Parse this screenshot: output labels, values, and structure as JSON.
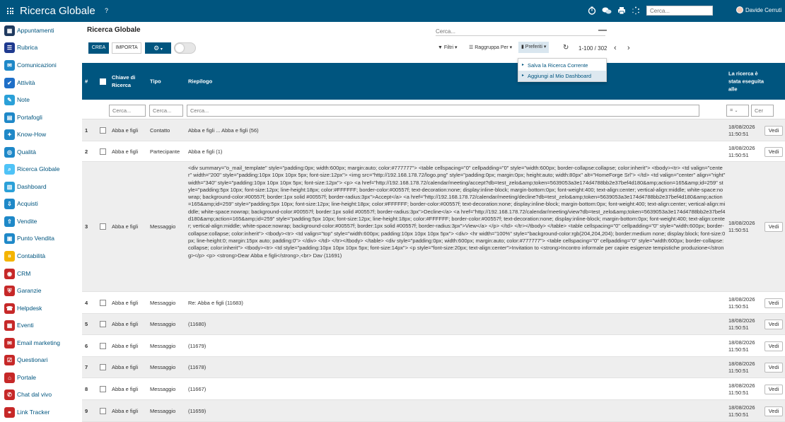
{
  "topbar": {
    "title": "Ricerca Globale",
    "help": "?",
    "search_placeholder": "Cerca...",
    "user": "Davide Cerruti"
  },
  "sidebar": {
    "items": [
      {
        "label": "Appuntamenti",
        "icon": "calendar-icon",
        "color": "#1f3a5f"
      },
      {
        "label": "Rubrica",
        "icon": "contacts-icon",
        "color": "#1f3a8f"
      },
      {
        "label": "Comunicazioni",
        "icon": "chat-icon",
        "color": "#1e88c8"
      },
      {
        "label": "Attività",
        "icon": "check-icon",
        "color": "#1e6fc8"
      },
      {
        "label": "Note",
        "icon": "notes-icon",
        "color": "#2aa0d8"
      },
      {
        "label": "Portafogli",
        "icon": "wallet-icon",
        "color": "#1e88c8"
      },
      {
        "label": "Know-How",
        "icon": "knowhow-icon",
        "color": "#1e88c8"
      },
      {
        "label": "Qualità",
        "icon": "quality-icon",
        "color": "#1e88c8"
      },
      {
        "label": "Ricerca Globale",
        "icon": "search-icon",
        "color": "#4fc3f7"
      },
      {
        "label": "Dashboard",
        "icon": "dashboard-icon",
        "color": "#2aa0d8"
      },
      {
        "label": "Acquisti",
        "icon": "purchase-icon",
        "color": "#1e88c8"
      },
      {
        "label": "Vendite",
        "icon": "sales-icon",
        "color": "#1e88c8"
      },
      {
        "label": "Punto Vendita",
        "icon": "pos-icon",
        "color": "#1e88c8"
      },
      {
        "label": "Contabilità",
        "icon": "accounting-icon",
        "color": "#f4b400"
      },
      {
        "label": "CRM",
        "icon": "crm-icon",
        "color": "#c62828"
      },
      {
        "label": "Garanzie",
        "icon": "warranty-icon",
        "color": "#c62828"
      },
      {
        "label": "Helpdesk",
        "icon": "helpdesk-icon",
        "color": "#c62828"
      },
      {
        "label": "Eventi",
        "icon": "events-icon",
        "color": "#c62828"
      },
      {
        "label": "Email marketing",
        "icon": "email-icon",
        "color": "#c62828"
      },
      {
        "label": "Questionari",
        "icon": "survey-icon",
        "color": "#c62828"
      },
      {
        "label": "Portale",
        "icon": "portal-icon",
        "color": "#c62828"
      },
      {
        "label": "Chat dal vivo",
        "icon": "livechat-icon",
        "color": "#c62828"
      },
      {
        "label": "Link Tracker",
        "icon": "link-icon",
        "color": "#c62828"
      }
    ]
  },
  "controlpanel": {
    "title": "Ricerca Globale",
    "search_placeholder": "Cerca...",
    "crea": "CREA",
    "importa": "IMPORTA",
    "filtri": "Filtri",
    "raggruppa": "Raggruppa Per",
    "preferiti": "Preferiti",
    "pager": "1-100 / 302"
  },
  "dropdown": {
    "items": [
      "Salva la Ricerca Corrente",
      "Aggiungi al Mio Dashboard"
    ]
  },
  "table": {
    "headers": {
      "num": "#",
      "chiave": "Chiave di Ricerca",
      "tipo": "Tipo",
      "riepilogo": "Riepilogo",
      "eseguita": "La ricerca è stata eseguita alle"
    },
    "filters": {
      "chiave": "Cerca...",
      "tipo": "Cerca...",
      "riepilogo": "Cerca...",
      "date": "=",
      "date2": "Cer"
    },
    "vedi": "Vedi",
    "rows": [
      {
        "num": "1",
        "chiave": "Abba e figli",
        "tipo": "Contatto",
        "riepilogo": "Abba e figli ... Abba e figli (56)",
        "date": "18/08/2026",
        "time": "11:50:51"
      },
      {
        "num": "2",
        "chiave": "Abba e figli",
        "tipo": "Partecipante",
        "riepilogo": "Abba e figli (1)",
        "date": "18/08/2026",
        "time": "11:50:51"
      },
      {
        "num": "3",
        "chiave": "Abba e figli",
        "tipo": "Messaggio",
        "riepilogo": "<div summary=\"o_mail_template\" style=\"padding:0px; width:600px; margin:auto; color:#777777\"> <table cellspacing=\"0\" cellpadding=\"0\" style=\"width:600px; border-collapse:collapse; color:inherit\"> <tbody><tr> <td valign=\"center\" width=\"200\" style=\"padding:10px 10px 10px 5px; font-size:12px\"> <img src=\"http://192.168.178.72/logo.png\" style=\"padding:0px; margin:0px; height:auto; width:80px\" alt=\"HomeForge Srl\"> </td> <td valign=\"center\" align=\"right\" width=\"340\" style=\"padding:10px 10px 10px 5px; font-size:12px\"> <p> <a href=\"http://192.168.178.72/calendar/meeting/accept?db=test_zelo&amp;token=5639053a3e174d4788bb2e37bef4d180&amp;action=165&amp;id=259\" style=\"padding:5px 10px; font-size:12px; line-height:18px; color:#FFFFFF; border-color:#00557f; text-decoration:none; display:inline-block; margin-bottom:0px; font-weight:400; text-align:center; vertical-align:middle; white-space:nowrap; background-color:#00557f; border:1px solid #00557f; border-radius:3px\">Accept</a> <a href=\"http://192.168.178.72/calendar/meeting/decline?db=test_zelo&amp;token=5639053a3e174d4788bb2e37bef4d180&amp;action=165&amp;id=259\" style=\"padding:5px 10px; font-size:12px; line-height:18px; color:#FFFFFF; border-color:#00557f; text-decoration:none; display:inline-block; margin-bottom:0px; font-weight:400; text-align:center; vertical-align:middle; white-space:nowrap; background-color:#00557f; border:1px solid #00557f; border-radius:3px\">Decline</a> <a href=\"http://192.168.178.72/calendar/meeting/view?db=test_zelo&amp;token=5639053a3e174d4788bb2e37bef4d180&amp;action=165&amp;id=259\" style=\"padding:5px 10px; font-size:12px; line-height:18px; color:#FFFFFF; border-color:#00557f; text-decoration:none; display:inline-block; margin-bottom:0px; font-weight:400; text-align:center; vertical-align:middle; white-space:nowrap; background-color:#00557f; border:1px solid #00557f; border-radius:3px\">View</a> </p> </td> </tr></tbody> </table> <table cellspacing=\"0\" cellpadding=\"0\" style=\"width:600px; border-collapse:collapse; color:inherit\"> <tbody><tr> <td valign=\"top\" style=\"width:600px; padding:10px 10px 10px 5px\"> <div> <hr width=\"100%\" style=\"background-color:rgb(204,204,204); border:medium none; display:block; font-size:0px; line-height:0; margin:15px auto; padding:0\"> </div> </td> </tr></tbody> </table> <div style=\"padding:0px; width:600px; margin:auto; color:#777777\"> <table cellspacing=\"0\" cellpadding=\"0\" style=\"width:600px; border-collapse:collapse; color:inherit\"> <tbody><tr> <td style=\"padding:10px 10px 10px 5px; font-size:14px\"> <p style=\"font-size:20px; text-align:center\">Invitation to <strong>Incontro informale per capire esigenze tempistiche produzione</strong></p> <p> <strong>Dear Abba e figli</strong>,<br> Dav (11691)",
        "date": "18/08/2026",
        "time": "11:50:51"
      },
      {
        "num": "4",
        "chiave": "Abba e figli",
        "tipo": "Messaggio",
        "riepilogo": "Re: Abba e figli (11683)",
        "date": "18/08/2026",
        "time": "11:50:51"
      },
      {
        "num": "5",
        "chiave": "Abba e figli",
        "tipo": "Messaggio",
        "riepilogo": "(11680)",
        "date": "18/08/2026",
        "time": "11:50:51"
      },
      {
        "num": "6",
        "chiave": "Abba e figli",
        "tipo": "Messaggio",
        "riepilogo": "(11679)",
        "date": "18/08/2026",
        "time": "11:50:51"
      },
      {
        "num": "7",
        "chiave": "Abba e figli",
        "tipo": "Messaggio",
        "riepilogo": "(11678)",
        "date": "18/08/2026",
        "time": "11:50:51"
      },
      {
        "num": "8",
        "chiave": "Abba e figli",
        "tipo": "Messaggio",
        "riepilogo": "(11667)",
        "date": "18/08/2026",
        "time": "11:50:51"
      },
      {
        "num": "9",
        "chiave": "Abba e figli",
        "tipo": "Messaggio",
        "riepilogo": "(11659)",
        "date": "18/08/2026",
        "time": "11:50:51"
      }
    ]
  }
}
